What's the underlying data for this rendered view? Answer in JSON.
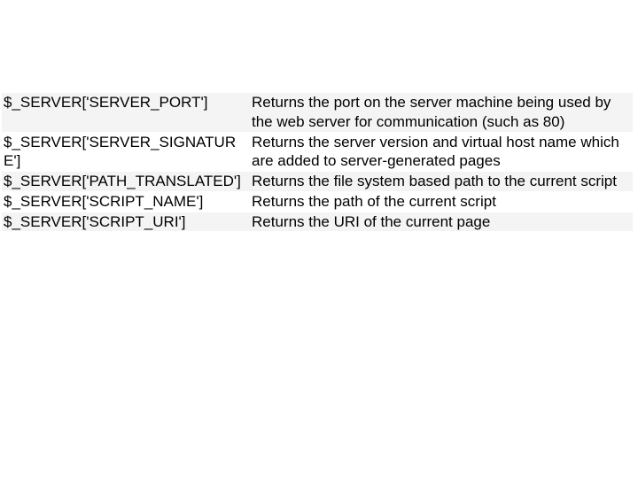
{
  "rows": [
    {
      "key": "$_SERVER['SERVER_PORT']",
      "desc": "Returns the port on the server machine being used by the web server for communication (such as 80)"
    },
    {
      "key": "$_SERVER['SERVER_SIGNATURE']",
      "desc": "Returns the server version and virtual host name which are added to server-generated pages"
    },
    {
      "key": "$_SERVER['PATH_TRANSLATED']",
      "desc": "Returns the file system based path to the current script"
    },
    {
      "key": "$_SERVER['SCRIPT_NAME']",
      "desc": "Returns the path of the current script"
    },
    {
      "key": "$_SERVER['SCRIPT_URI']",
      "desc": "Returns the URI of the current page"
    }
  ]
}
